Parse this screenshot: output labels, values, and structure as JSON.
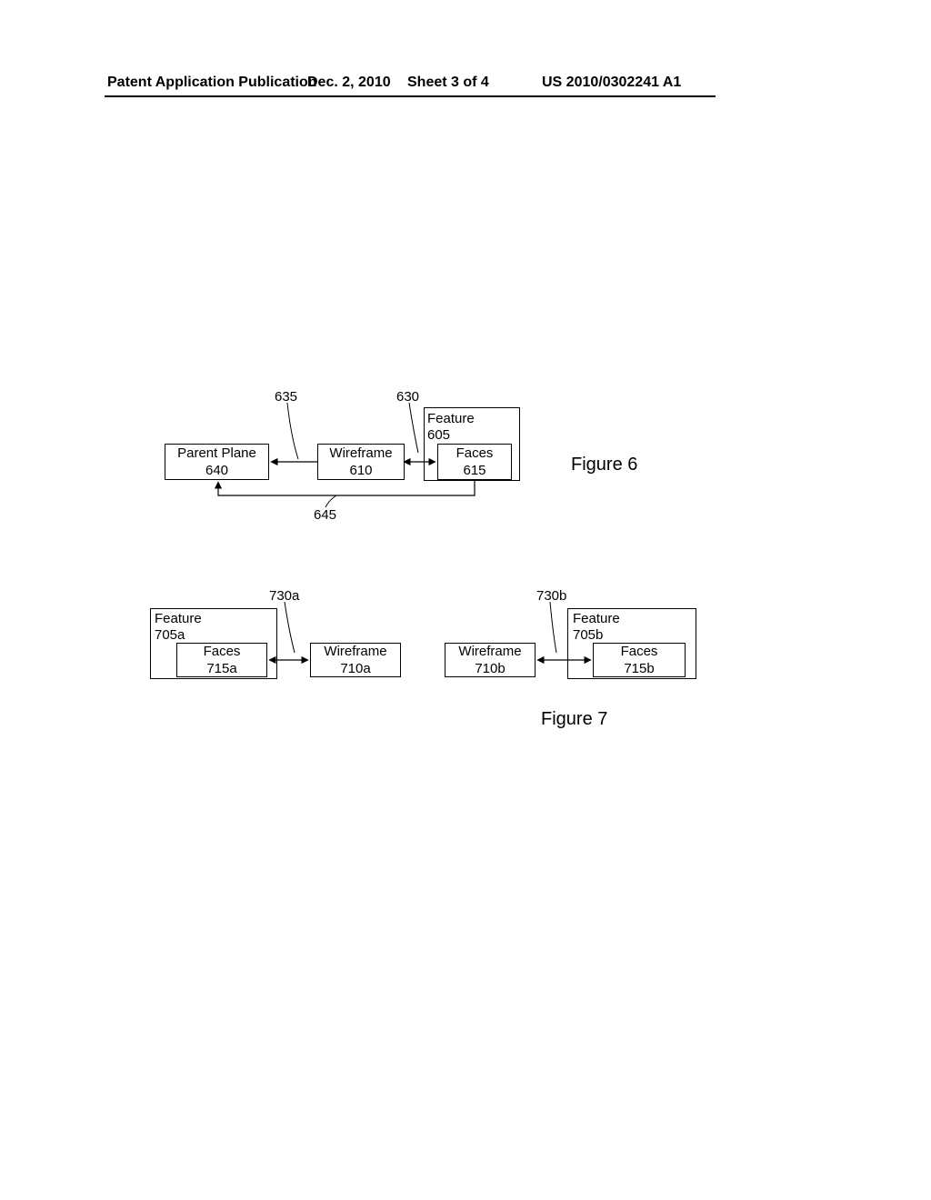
{
  "header": {
    "publication": "Patent Application Publication",
    "date": "Dec. 2, 2010",
    "sheet": "Sheet 3 of 4",
    "number": "US 2010/0302241 A1"
  },
  "fig6": {
    "caption": "Figure 6",
    "labels": {
      "l635": "635",
      "l630": "630",
      "l645": "645"
    },
    "boxes": {
      "feature": {
        "line1": "Feature",
        "line2": "605"
      },
      "parentPlane": {
        "line1": "Parent Plane",
        "line2": "640"
      },
      "wireframe": {
        "line1": "Wireframe",
        "line2": "610"
      },
      "faces": {
        "line1": "Faces",
        "line2": "615"
      }
    }
  },
  "fig7": {
    "caption": "Figure 7",
    "labels": {
      "l730a": "730a",
      "l730b": "730b"
    },
    "boxes": {
      "featureA": {
        "line1": "Feature",
        "line2": "705a"
      },
      "facesA": {
        "line1": "Faces",
        "line2": "715a"
      },
      "wireframeA": {
        "line1": "Wireframe",
        "line2": "710a"
      },
      "featureB": {
        "line1": "Feature",
        "line2": "705b"
      },
      "facesB": {
        "line1": "Faces",
        "line2": "715b"
      },
      "wireframeB": {
        "line1": "Wireframe",
        "line2": "710b"
      }
    }
  }
}
